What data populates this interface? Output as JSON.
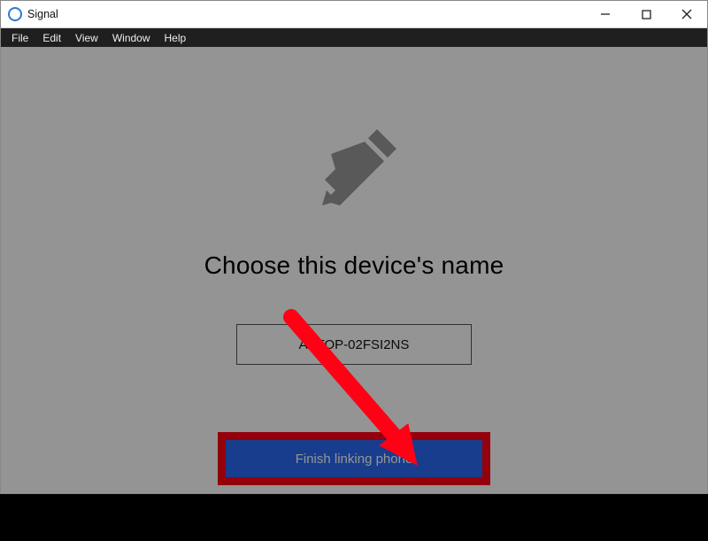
{
  "window": {
    "title": "Signal",
    "controls": {
      "min": "minimize-icon",
      "max": "maximize-icon",
      "close": "close-icon"
    }
  },
  "menubar": [
    "File",
    "Edit",
    "View",
    "Window",
    "Help"
  ],
  "main": {
    "icon": "pencil-icon",
    "heading": "Choose this device's name",
    "device_name_value": "APTOP-02FSI2NS",
    "finish_label": "Finish linking phone"
  },
  "annotation": {
    "arrow_color": "#ff0015",
    "highlight_color": "#ff0015"
  }
}
